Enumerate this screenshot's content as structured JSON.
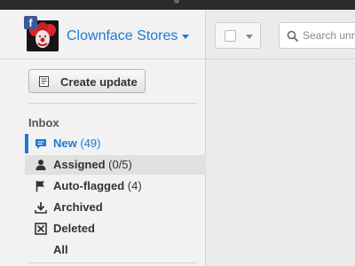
{
  "account": {
    "name": "Clownface Stores",
    "network_badge": "f",
    "avatar_icon": "clown-avatar",
    "accent_color": "#1d7ad3"
  },
  "toolbar": {
    "search_placeholder": "Search unread"
  },
  "sidebar": {
    "create_label": "Create update",
    "inbox_title": "Inbox",
    "items": [
      {
        "label": "New",
        "count": "(49)",
        "icon": "speech-bubble-icon",
        "state": "active"
      },
      {
        "label": "Assigned",
        "count": "(0/5)",
        "icon": "person-icon",
        "state": "selected"
      },
      {
        "label": "Auto-flagged",
        "count": "(4)",
        "icon": "flag-icon",
        "state": ""
      },
      {
        "label": "Archived",
        "count": "",
        "icon": "download-tray-icon",
        "state": ""
      },
      {
        "label": "Deleted",
        "count": "",
        "icon": "x-box-icon",
        "state": ""
      },
      {
        "label": "All",
        "count": "",
        "icon": "",
        "state": ""
      }
    ]
  }
}
